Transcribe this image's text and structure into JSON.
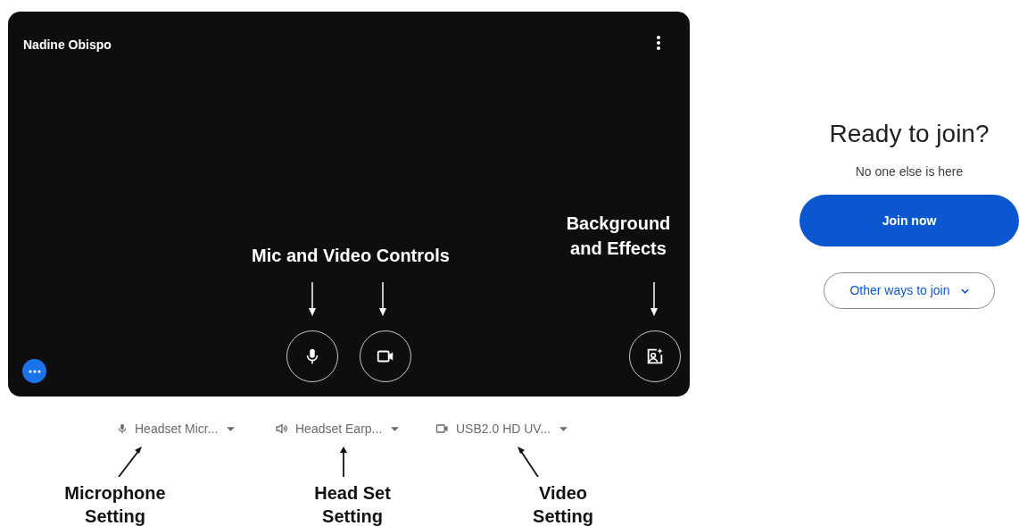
{
  "video_preview": {
    "participant_name": "Nadine Obispo"
  },
  "controls": [
    {
      "kind": "mic"
    },
    {
      "kind": "camera"
    },
    {
      "kind": "effects"
    }
  ],
  "annotations_in_preview": [
    {
      "text": "Mic and Video Controls"
    },
    {
      "text": "Background and Effects"
    }
  ],
  "device_selectors": [
    {
      "kind": "mic",
      "label": "Headset Micr..."
    },
    {
      "kind": "speaker",
      "label": "Headset Earp..."
    },
    {
      "kind": "camera",
      "label": "USB2.0 HD UV..."
    }
  ],
  "device_annotations": [
    {
      "line1": "Microphone",
      "line2": "Setting"
    },
    {
      "line1": "Head Set",
      "line2": "Setting"
    },
    {
      "line1": "Video",
      "line2": "Setting"
    }
  ],
  "join_panel": {
    "title": "Ready to join?",
    "status": "No one else is here",
    "join_button": "Join now",
    "other_button": "Other ways to join"
  }
}
